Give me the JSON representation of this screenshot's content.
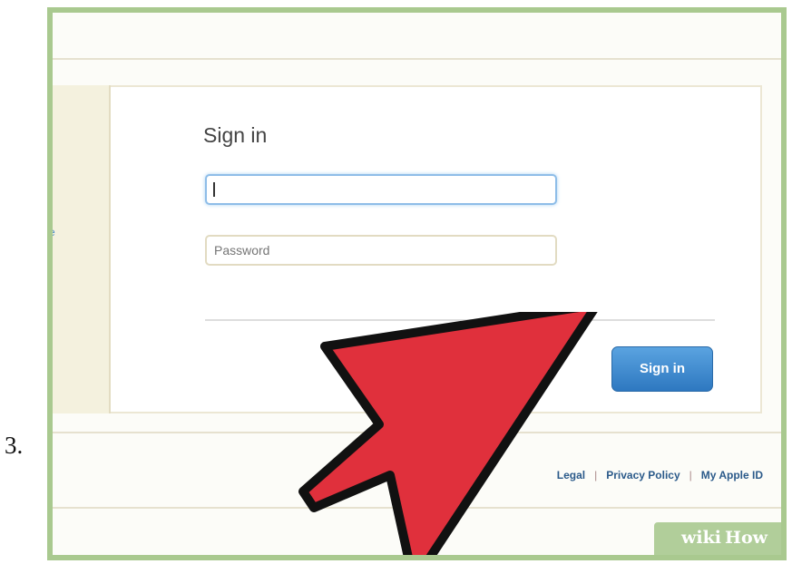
{
  "step": {
    "number": "3."
  },
  "signin": {
    "title": "Sign in",
    "apple_id_value": "",
    "password_placeholder": "Password",
    "button_label": "Sign in"
  },
  "footer": {
    "links": [
      "Legal",
      "Privacy Policy",
      "My Apple ID"
    ],
    "separator": "|"
  },
  "watermark": {
    "text": "wikiHow"
  },
  "colors": {
    "frame_border": "#a9c98f",
    "button_blue": "#2e78c0",
    "arrow_red": "#e0303c",
    "link_blue": "#2b5a8a",
    "focus_blue": "#8ebde8"
  },
  "icons": {
    "pointer": "red-arrow-icon"
  }
}
